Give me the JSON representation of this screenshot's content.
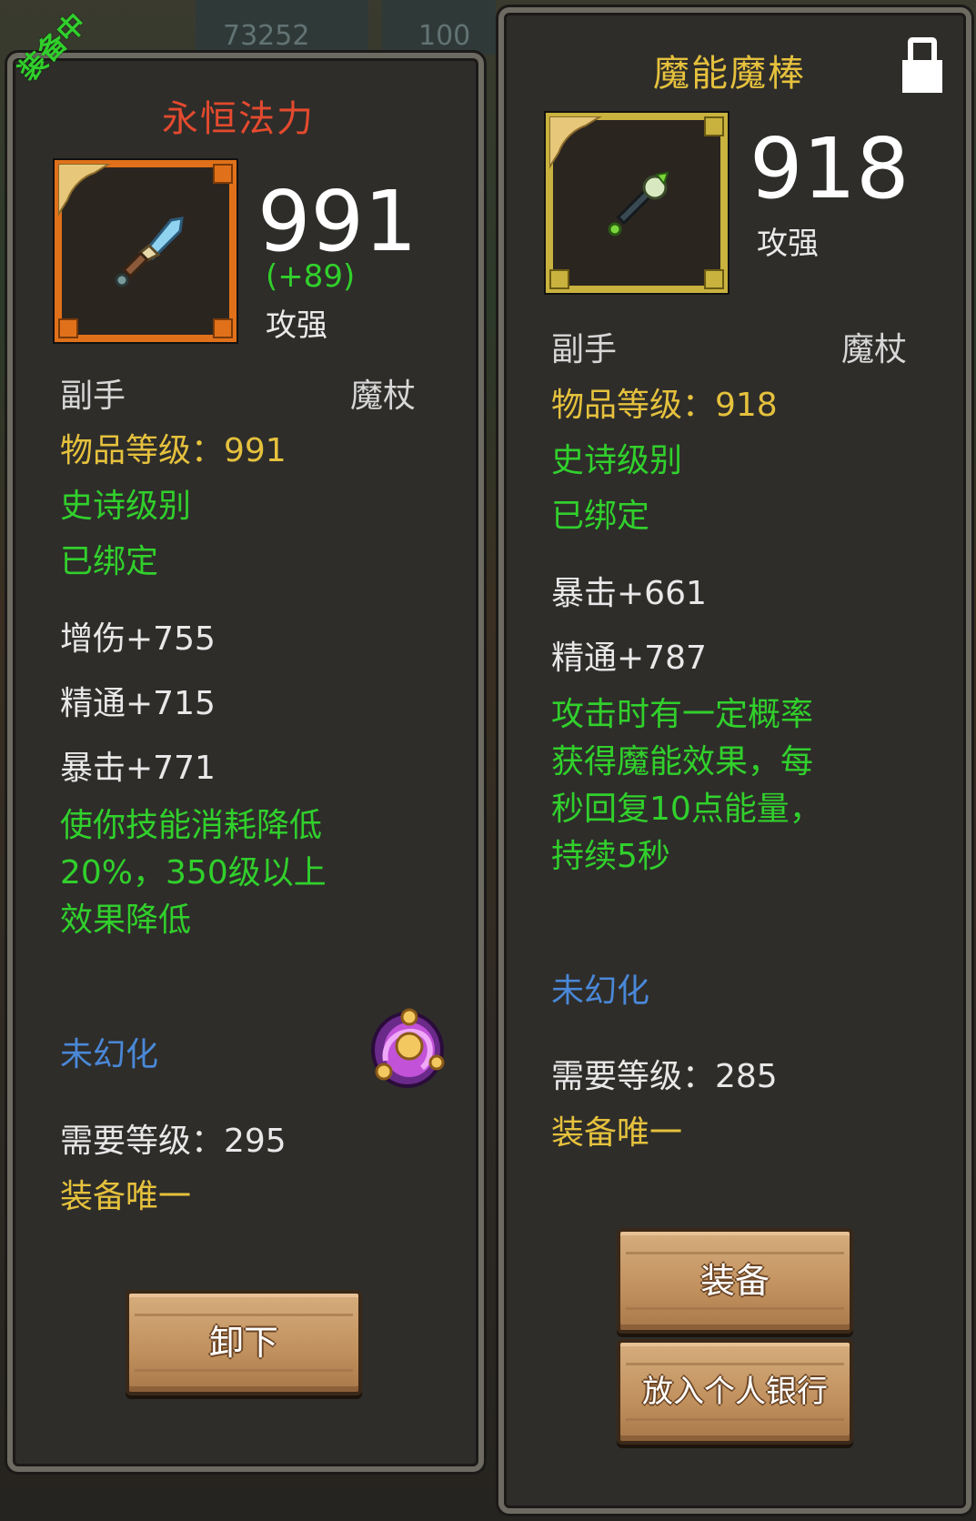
{
  "background": {
    "numbers": [
      "73252",
      "100"
    ]
  },
  "left_item": {
    "equipped_tag": "装备中",
    "name": "永恒法力",
    "name_color": "#e44a2e",
    "power": "991",
    "power_bonus": "(+89)",
    "power_label": "攻强",
    "slot": "副手",
    "type": "魔杖",
    "item_level": "物品等级：991",
    "rarity": "史诗级别",
    "bound": "已绑定",
    "stats": [
      "增伤+755",
      "精通+715",
      "暴击+771"
    ],
    "effect_lines": [
      "使你技能消耗降低",
      "20%，350级以上",
      "效果降低"
    ],
    "transmog": "未幻化",
    "required_level": "需要等级：295",
    "unique": "装备唯一",
    "button_unequip": "卸下",
    "icon": "frost-dagger-icon",
    "badge_icon": "purple-orb-icon"
  },
  "right_item": {
    "name": "魔能魔棒",
    "name_color": "#e5c13d",
    "power": "918",
    "power_label": "攻强",
    "slot": "副手",
    "type": "魔杖",
    "item_level": "物品等级：918",
    "rarity": "史诗级别",
    "bound": "已绑定",
    "stats": [
      "暴击+661",
      "精通+787"
    ],
    "effect_lines": [
      "攻击时有一定概率",
      "获得魔能效果，每",
      "秒回复10点能量，",
      "持续5秒"
    ],
    "transmog": "未幻化",
    "required_level": "需要等级：285",
    "unique": "装备唯一",
    "button_equip": "装备",
    "button_bank": "放入个人银行",
    "icon": "green-wand-icon",
    "lock_icon": "lock-icon"
  },
  "colors": {
    "epic_green": "#31d02c",
    "level_yellow": "#e5c13d",
    "transmog_blue": "#4a88d8",
    "frame_orange": "#e0711a",
    "frame_gold": "#c9b23e"
  }
}
